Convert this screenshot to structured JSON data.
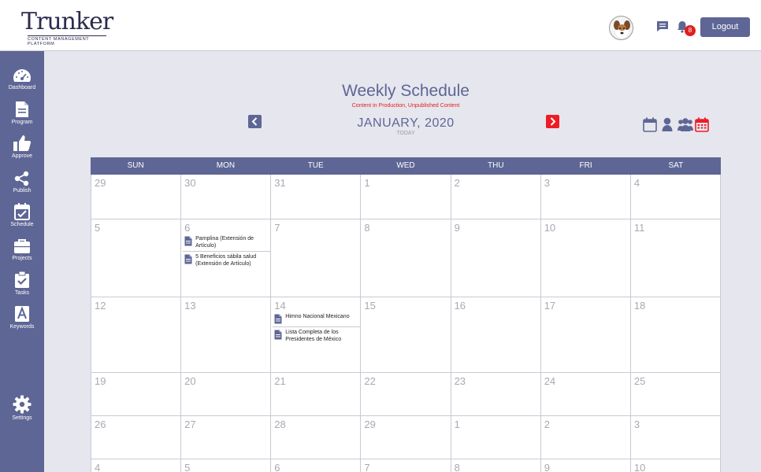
{
  "brand": {
    "name": "Trunker",
    "tagline": "CONTENT MANAGEMENT PLATFORM"
  },
  "header": {
    "notification_count": "8",
    "logout_label": "Logout"
  },
  "sidebar": {
    "items": [
      {
        "label": "Dashboard",
        "icon": "dashboard-icon"
      },
      {
        "label": "Program",
        "icon": "document-icon"
      },
      {
        "label": "Approve",
        "icon": "thumbs-up-icon"
      },
      {
        "label": "Publish",
        "icon": "share-icon"
      },
      {
        "label": "Schedule",
        "icon": "calendar-check-icon"
      },
      {
        "label": "Projects",
        "icon": "briefcase-icon"
      },
      {
        "label": "Tasks",
        "icon": "clipboard-check-icon"
      },
      {
        "label": "Keywords",
        "icon": "letter-a-icon"
      },
      {
        "label": "Settings",
        "icon": "gear-icon"
      }
    ]
  },
  "page": {
    "title": "Weekly Schedule",
    "subtitle": "Content in Production, Unpublished Content",
    "month": "JANUARY, 2020",
    "today_label": "TODAY"
  },
  "colors": {
    "primary": "#5e6695",
    "accent_red": "#ee1c25",
    "text_red": "#e02020"
  },
  "calendar": {
    "weekdays": [
      "SUN",
      "MON",
      "TUE",
      "WED",
      "THU",
      "FRI",
      "SAT"
    ],
    "weeks": [
      {
        "days": [
          {
            "n": "29"
          },
          {
            "n": "30"
          },
          {
            "n": "31"
          },
          {
            "n": "1"
          },
          {
            "n": "2"
          },
          {
            "n": "3"
          },
          {
            "n": "4"
          }
        ]
      },
      {
        "days": [
          {
            "n": "5"
          },
          {
            "n": "6",
            "events": [
              "Pamplina (Extensión de Artículo)",
              "5 Beneficios sábila salud (Extensión de Artículo)"
            ]
          },
          {
            "n": "7"
          },
          {
            "n": "8"
          },
          {
            "n": "9"
          },
          {
            "n": "10"
          },
          {
            "n": "11"
          }
        ]
      },
      {
        "days": [
          {
            "n": "12"
          },
          {
            "n": "13"
          },
          {
            "n": "14",
            "events": [
              "Himno Nacional Mexicano",
              "Lista Completa de los Presidentes de México"
            ]
          },
          {
            "n": "15"
          },
          {
            "n": "16"
          },
          {
            "n": "17"
          },
          {
            "n": "18"
          }
        ]
      },
      {
        "days": [
          {
            "n": "19"
          },
          {
            "n": "20"
          },
          {
            "n": "21"
          },
          {
            "n": "22"
          },
          {
            "n": "23"
          },
          {
            "n": "24"
          },
          {
            "n": "25"
          }
        ]
      },
      {
        "days": [
          {
            "n": "26"
          },
          {
            "n": "27"
          },
          {
            "n": "28"
          },
          {
            "n": "29"
          },
          {
            "n": "1"
          },
          {
            "n": "2"
          },
          {
            "n": "3"
          }
        ]
      },
      {
        "days": [
          {
            "n": "4"
          },
          {
            "n": "5"
          },
          {
            "n": "6"
          },
          {
            "n": "7"
          },
          {
            "n": "8"
          },
          {
            "n": "9"
          },
          {
            "n": "10"
          }
        ]
      }
    ]
  }
}
